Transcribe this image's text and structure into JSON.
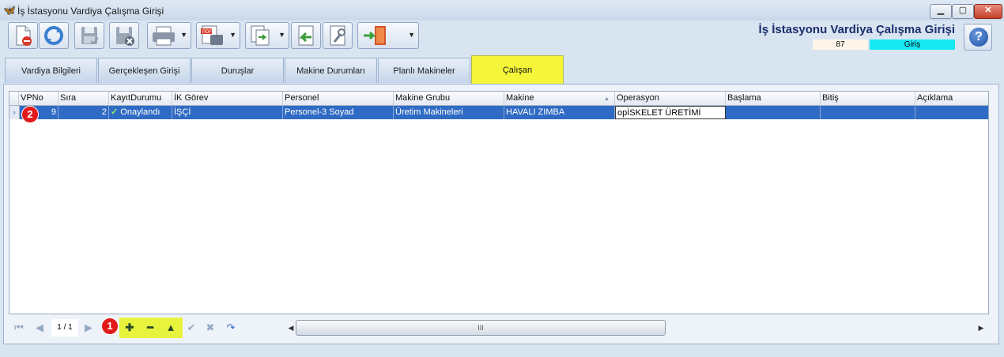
{
  "window": {
    "title": "İş İstasyonu Vardiya Çalışma Girişi",
    "minimize_glyph": "▁",
    "maximize_glyph": "▢",
    "close_glyph": "✕"
  },
  "header": {
    "title": "İş İstasyonu Vardiya Çalışma Girişi",
    "number": "87",
    "mode": "Giriş"
  },
  "toolbar": {
    "buttons": [
      "new-document-icon",
      "refresh-icon",
      "save-icon",
      "save-close-icon",
      "printer-icon",
      "pdf-export-icon",
      "export-icon",
      "back-icon",
      "tools-icon",
      "exit-door-icon"
    ],
    "help_glyph": "?"
  },
  "tabs": [
    {
      "label": "Vardiya Bilgileri",
      "active": false
    },
    {
      "label": "Gerçekleşen Girişi",
      "active": false
    },
    {
      "label": "Duruşlar",
      "active": false
    },
    {
      "label": "Makine Durumları",
      "active": false
    },
    {
      "label": "Planlı Makineler",
      "active": false
    },
    {
      "label": "Çalışan",
      "active": true
    }
  ],
  "grid": {
    "columns": [
      "VPNo",
      "Sıra",
      "KayıtDurumu",
      "İK Görev",
      "Personel",
      "Makine Grubu",
      "Makine",
      "Operasyon",
      "Başlama",
      "Bitiş",
      "Açıklama"
    ],
    "rows": [
      {
        "vpno": "9",
        "sira": "2",
        "kayit_durumu": "Onaylandı",
        "ik_gorev": "İŞÇİ",
        "personel": "Personel-3 Soyad",
        "makine_grubu": "Üretim Makineleri",
        "makine": "HAVALI ZIMBA",
        "operasyon": "opİSKELET ÜRETİMİ",
        "baslama": "",
        "bitis": "",
        "aciklama": ""
      }
    ],
    "sort_glyph": "▲",
    "row_indicator_glyph": "›",
    "status_check_glyph": "✓"
  },
  "navigator": {
    "page_info": "1 / 1",
    "first_glyph": "⏮",
    "prev_glyph": "◀",
    "next_glyph": "▶",
    "add_glyph": "✚",
    "remove_glyph": "━",
    "up_glyph": "▲",
    "confirm_glyph": "✔",
    "cancel_glyph": "✖",
    "redo_glyph": "↷",
    "scroll_left_glyph": "◀",
    "scroll_right_glyph": "▶",
    "scroll_thumb_grip": "III"
  },
  "badges": {
    "one": "1",
    "two": "2"
  },
  "colors": {
    "selected_row": "#2f6bc4",
    "active_tab": "#f5f53a",
    "mode_box": "#17e9f2",
    "badge": "#e21a1a"
  }
}
